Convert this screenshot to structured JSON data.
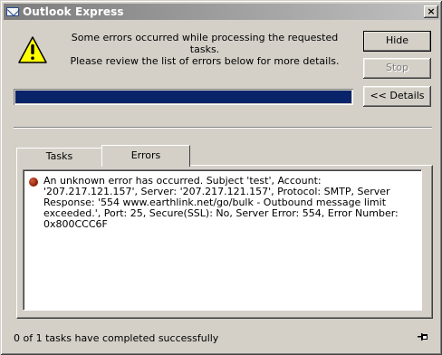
{
  "window": {
    "title": "Outlook Express",
    "close_label": "×"
  },
  "message": {
    "line1": "Some errors occurred while processing the requested tasks.",
    "line2": "Please review the list of errors below for more details."
  },
  "buttons": {
    "hide": "Hide",
    "stop": "Stop",
    "details": "<< Details"
  },
  "progress": {
    "fraction": 1.0
  },
  "tabs": {
    "tasks": "Tasks",
    "errors": "Errors",
    "selected": "errors"
  },
  "errors": {
    "items": [
      {
        "icon": "error-circle-icon",
        "text": "An unknown error has occurred. Subject 'test', Account: '207.217.121.157', Server: '207.217.121.157', Protocol: SMTP, Server Response: '554 www.earthlink.net/go/bulk - Outbound message limit exceeded.', Port: 25, Secure(SSL): No, Server Error: 554, Error Number: 0x800CCC6F"
      }
    ]
  },
  "status": {
    "text": "0 of 1 tasks have completed successfully",
    "pin_icon": "pushpin-icon"
  },
  "colors": {
    "dialog_bg": "#d4d0c8",
    "progress_fill": "#0a246a",
    "title_gradient_start": "#7c7c7c",
    "title_gradient_end": "#c0c0c0"
  }
}
